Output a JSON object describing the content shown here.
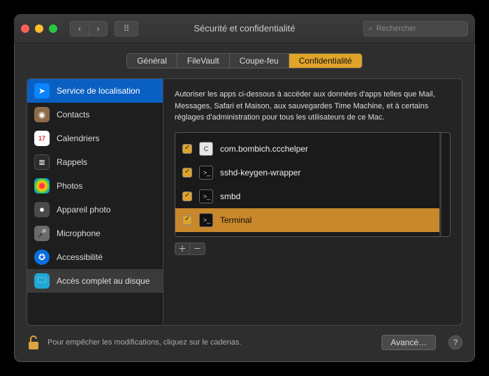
{
  "window": {
    "title": "Sécurité et confidentialité",
    "search_placeholder": "Rechercher"
  },
  "tabs": [
    {
      "label": "Général",
      "active": false
    },
    {
      "label": "FileVault",
      "active": false
    },
    {
      "label": "Coupe-feu",
      "active": false
    },
    {
      "label": "Confidentialité",
      "active": true
    }
  ],
  "sidebar": {
    "items": [
      {
        "label": "Service de localisation",
        "icon": "location",
        "selected": true
      },
      {
        "label": "Contacts",
        "icon": "contacts"
      },
      {
        "label": "Calendriers",
        "icon": "calendar"
      },
      {
        "label": "Rappels",
        "icon": "reminders"
      },
      {
        "label": "Photos",
        "icon": "photos"
      },
      {
        "label": "Appareil photo",
        "icon": "camera"
      },
      {
        "label": "Microphone",
        "icon": "microphone"
      },
      {
        "label": "Accessibilité",
        "icon": "accessibility"
      },
      {
        "label": "Accès complet au disque",
        "icon": "full-disk",
        "highlight": true
      }
    ]
  },
  "main": {
    "description": "Autoriser les apps ci-dessous à accéder aux données d'apps telles que Mail, Messages, Safari et Maison, aux sauvegardes Time Machine, et à certains réglages d'administration pour tous les utilisateurs de ce Mac.",
    "apps": [
      {
        "name": "com.bombich.ccchelper",
        "icon": "ccc",
        "checked": true,
        "selected": false
      },
      {
        "name": "sshd-keygen-wrapper",
        "icon": "terminal",
        "checked": true,
        "selected": false
      },
      {
        "name": "smbd",
        "icon": "terminal",
        "checked": true,
        "selected": false
      },
      {
        "name": "Terminal",
        "icon": "terminal",
        "checked": true,
        "selected": true
      }
    ],
    "plus": "＋",
    "minus": "－"
  },
  "footer": {
    "lock_hint": "Pour empêcher les modifications, cliquez sur le cadenas.",
    "advanced_label": "Avancé…",
    "help": "?"
  },
  "icons": {
    "chevron_left": "‹",
    "chevron_right": "›",
    "grid": "⠿",
    "search": "⌕",
    "calendar_day": "17"
  }
}
